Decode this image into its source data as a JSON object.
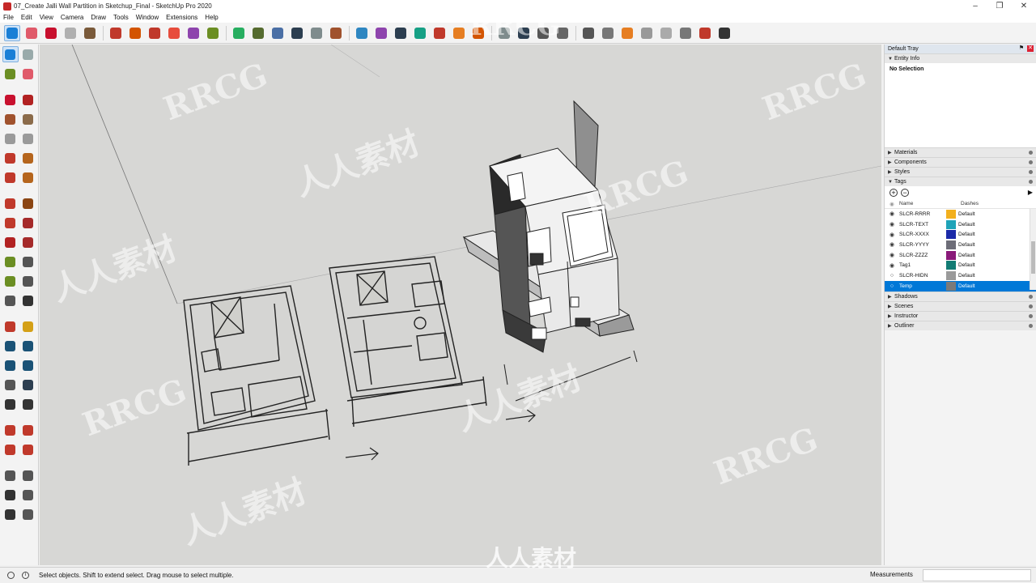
{
  "window": {
    "title": "07_Create Jalli Wall Partition in Sketchup_Final - SketchUp Pro 2020",
    "controls": [
      "–",
      "❐",
      "✕"
    ]
  },
  "menu": [
    "File",
    "Edit",
    "View",
    "Camera",
    "Draw",
    "Tools",
    "Window",
    "Extensions",
    "Help"
  ],
  "tray": {
    "title": "Default Tray",
    "entity_info": {
      "label": "Entity Info",
      "value": "No Selection"
    },
    "panels_before_tags": [
      "Materials",
      "Components",
      "Styles"
    ],
    "tags": {
      "label": "Tags",
      "columns": {
        "name": "Name",
        "dashes": "Dashes"
      },
      "rows": [
        {
          "name": "SLCR-RRRR",
          "color": "#f2b01e",
          "dashes": "Default",
          "visible": true
        },
        {
          "name": "SLCR-TEXT",
          "color": "#1fa3b8",
          "dashes": "Default",
          "visible": true
        },
        {
          "name": "SLCR-XXXX",
          "color": "#1b2aa8",
          "dashes": "Default",
          "visible": true
        },
        {
          "name": "SLCR-YYYY",
          "color": "#6d6d78",
          "dashes": "Default",
          "visible": true
        },
        {
          "name": "SLCR-ZZZZ",
          "color": "#8a1a7a",
          "dashes": "Default",
          "visible": true
        },
        {
          "name": "Tag1",
          "color": "#137c74",
          "dashes": "Default",
          "visible": true
        },
        {
          "name": "SLCR-HIDN",
          "color": "#9a9a9a",
          "dashes": "Default",
          "visible": false
        },
        {
          "name": "Temp",
          "color": "#7a7a7a",
          "dashes": "Default",
          "visible": false,
          "selected": true
        }
      ]
    },
    "panels_after_tags": [
      "Shadows",
      "Scenes",
      "Instructor",
      "Outliner"
    ]
  },
  "status": {
    "message": "Select objects. Shift to extend select. Drag mouse to select multiple.",
    "measurements_label": "Measurements",
    "measurements_value": ""
  },
  "watermarks": {
    "latin": "RRCG",
    "cjk": "人人素材"
  },
  "icons": {
    "top": [
      "select-icon",
      "eraser-icon",
      "pencil-icon",
      "arc-icon",
      "rectangle-icon",
      "move-icon",
      "rotate-icon",
      "scale-icon",
      "pushpull-icon",
      "offset-icon",
      "followme-icon",
      "tape-icon",
      "protractor-icon",
      "text-icon",
      "axes-icon",
      "dimension-icon",
      "paint-icon",
      "orbit-icon",
      "pan-icon",
      "zoom-icon",
      "zoom-extents-icon",
      "sandbox-icon",
      "warehouse-icon",
      "extension-icon",
      "user-icon",
      "info-icon",
      "cloud-icon",
      "section-icon",
      "views-icon",
      "walk-icon",
      "play-icon",
      "stop-icon",
      "prev-icon",
      "stamp-icon",
      "pin-icon",
      "draw-icon"
    ],
    "left": [
      "select-icon",
      "component-icon",
      "paint-icon",
      "eraser-icon",
      "line-icon",
      "freehand-icon",
      "rectangle-icon",
      "rotated-rect-icon",
      "circle-icon",
      "polygon-icon",
      "arc-icon",
      "pie-icon",
      "3pt-arc-icon",
      "2pt-arc-icon",
      "move-icon",
      "pushpull-icon",
      "rotate-icon",
      "followme-icon",
      "scale-icon",
      "offset-icon",
      "tape-icon",
      "dimension-icon",
      "protractor-icon",
      "text-icon",
      "axes-icon",
      "3d-text-icon",
      "orbit-icon",
      "pan-icon",
      "zoom-icon",
      "zoom-window-icon",
      "zoom-extents-icon",
      "previous-view-icon",
      "position-camera-icon",
      "look-around-icon",
      "walk-icon",
      "section-plane-icon",
      "warehouse-icon",
      "extension-warehouse-icon",
      "send-layout-icon",
      "extension-manager-icon",
      "iso-view-icon",
      "front-view-icon",
      "home-view-icon",
      "side-view-icon",
      "top-view-icon",
      "back-view-icon"
    ]
  }
}
